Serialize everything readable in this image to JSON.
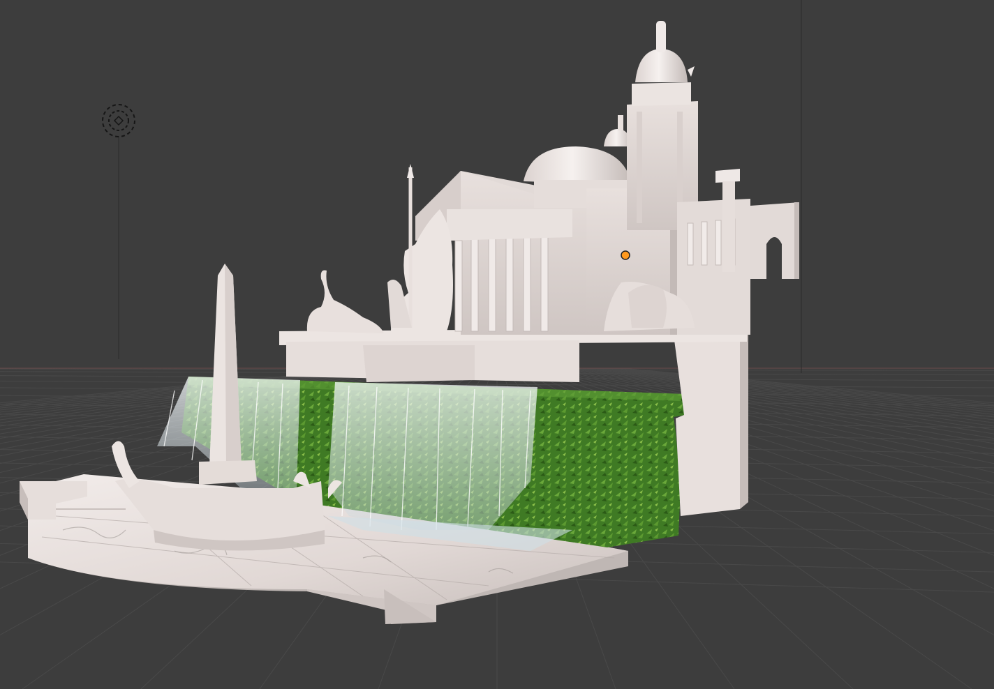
{
  "viewport": {
    "background": "#3d3d3d",
    "grid_color": "#4a4a4a",
    "horizon_x_axis_color": "#6a4a4a",
    "shading": "material-preview"
  },
  "scene": {
    "objects": [
      {
        "name": "light",
        "icon": "light-icon"
      },
      {
        "name": "camera-line",
        "icon": "camera-icon"
      },
      {
        "name": "fountain-model",
        "icon": "mesh-icon"
      },
      {
        "name": "origin",
        "icon": "origin-dot-icon"
      }
    ],
    "colors": {
      "marble": "#e4dcd8",
      "marble_shadow": "#b9b1ae",
      "marble_vein": "#9a9390",
      "foliage": "#4a8a2a",
      "foliage_dark": "#2f5e1a",
      "water": "#e8f0f4",
      "origin": "#ff9a1f"
    }
  }
}
